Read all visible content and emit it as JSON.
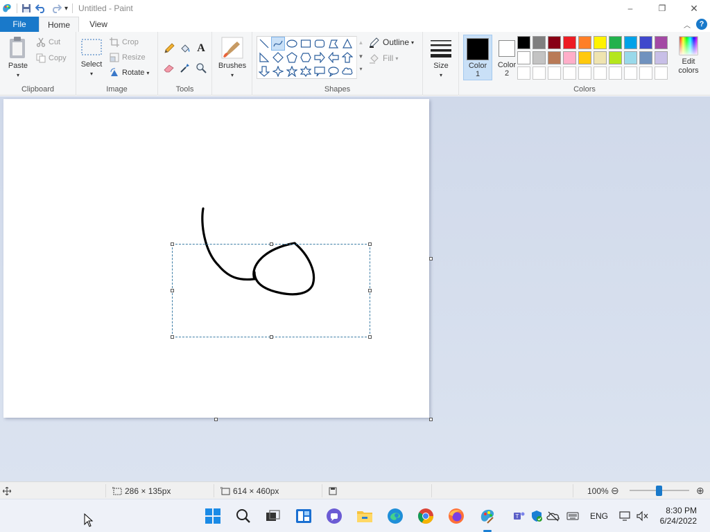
{
  "titlebar": {
    "title": "Untitled - Paint",
    "minimize": "–",
    "restore": "❐",
    "close": "✕"
  },
  "tabs": {
    "file": "File",
    "home": "Home",
    "view": "View",
    "help": "?"
  },
  "clipboard": {
    "paste": "Paste",
    "cut": "Cut",
    "copy": "Copy",
    "group": "Clipboard"
  },
  "image": {
    "select": "Select",
    "crop": "Crop",
    "resize": "Resize",
    "rotate": "Rotate",
    "group": "Image"
  },
  "tools": {
    "group": "Tools"
  },
  "brushes": {
    "label": "Brushes"
  },
  "shapes": {
    "outline": "Outline",
    "fill": "Fill",
    "group": "Shapes"
  },
  "size": {
    "label": "Size"
  },
  "colors": {
    "color1_line1": "Color",
    "color1_line2": "1",
    "color2_line1": "Color",
    "color2_line2": "2",
    "edit_line1": "Edit",
    "edit_line2": "colors",
    "group": "Colors",
    "color1_value": "#000000",
    "color2_value": "#ffffff",
    "palette_row1": [
      "#000000",
      "#7f7f7f",
      "#880015",
      "#ed1c24",
      "#ff7f27",
      "#fff200",
      "#22b14c",
      "#00a2e8",
      "#3f48cc",
      "#a349a4"
    ],
    "palette_row2": [
      "#ffffff",
      "#c3c3c3",
      "#b97a57",
      "#ffaec9",
      "#ffc90e",
      "#efe4b0",
      "#b5e61d",
      "#99d9ea",
      "#7092be",
      "#c8bfe7"
    ],
    "palette_row3": [
      "#ffffff",
      "#ffffff",
      "#ffffff",
      "#ffffff",
      "#ffffff",
      "#ffffff",
      "#ffffff",
      "#ffffff",
      "#ffffff",
      "#ffffff"
    ]
  },
  "status": {
    "selection_size": "286 × 135px",
    "canvas_size": "614 × 460px",
    "zoom": "100%"
  },
  "taskbar": {
    "language": "ENG",
    "time": "8:30 PM",
    "date": "6/24/2022"
  }
}
